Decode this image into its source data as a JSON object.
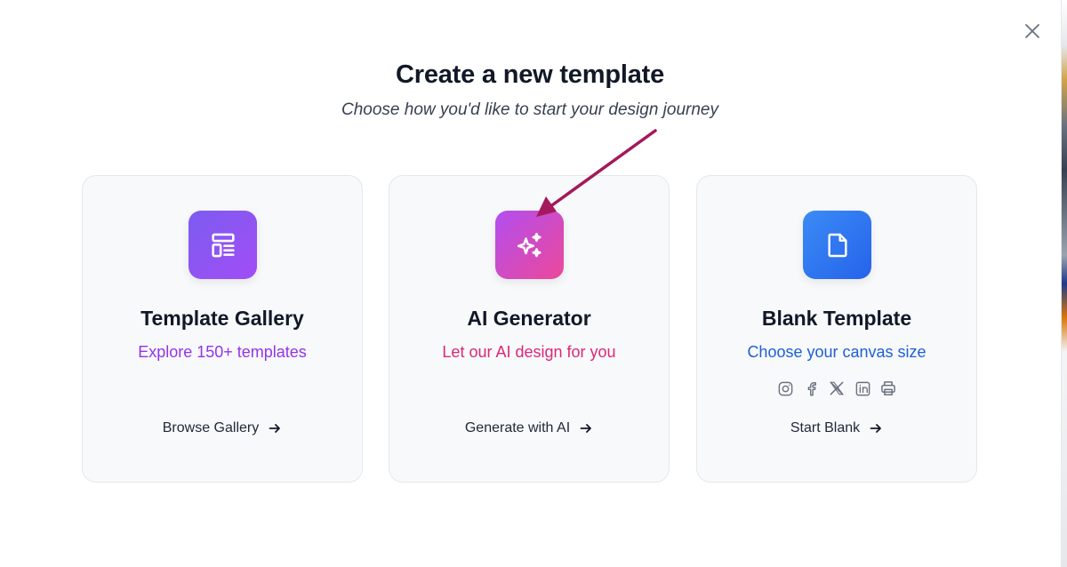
{
  "dialog": {
    "title": "Create a new template",
    "subtitle": "Choose how you'd like to start your design journey",
    "close_icon": "close-icon"
  },
  "cards": [
    {
      "id": "template-gallery",
      "title": "Template Gallery",
      "subtitle": "Explore 150+ templates",
      "subtitle_color": "#9333ea",
      "icon": "layout-icon",
      "tile_color": "#8b55f3",
      "action_label": "Browse Gallery"
    },
    {
      "id": "ai-generator",
      "title": "AI Generator",
      "subtitle": "Let our AI design for you",
      "subtitle_color": "#db2777",
      "icon": "sparkles-icon",
      "tile_color": "#d04bd0",
      "action_label": "Generate with AI"
    },
    {
      "id": "blank-template",
      "title": "Blank Template",
      "subtitle": "Choose your canvas size",
      "subtitle_color": "#1d5fd8",
      "icon": "file-icon",
      "tile_color": "#3079f0",
      "action_label": "Start Blank",
      "social_icons": [
        "instagram-icon",
        "facebook-icon",
        "x-icon",
        "linkedin-icon",
        "printer-icon"
      ]
    }
  ],
  "annotation": {
    "arrow_color": "#a3195b",
    "target": "ai-generator"
  }
}
